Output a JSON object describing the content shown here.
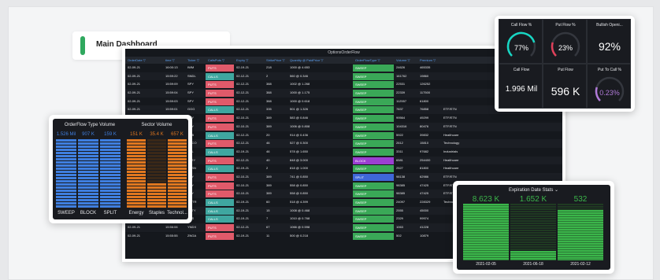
{
  "title": {
    "label": "Main Dashboard"
  },
  "table": {
    "title": "OptionsOrderFlow",
    "headers": [
      "OrderDate",
      "time",
      "Ticker",
      "CallsPuts",
      "Expiry",
      "StrikePrice",
      "Quantity @ PaidPrice",
      "OrderFlowType",
      "Volume",
      "Premium",
      ""
    ],
    "rows": [
      [
        "02-09-21",
        "16:00:13",
        "IWM",
        "PUTS",
        "02-19-21",
        "218",
        "1000 @ 4.653",
        "SWEEP",
        "24626",
        "465335",
        ""
      ],
      [
        "02-09-21",
        "15:59:22",
        "SNDL",
        "CALLS",
        "02-12-21",
        "2",
        "560 @ 0.346",
        "SWEEP",
        "161762",
        "19860",
        ""
      ],
      [
        "02-09-21",
        "15:59:09",
        "SPY",
        "PUTS",
        "02-12-21",
        "388",
        "1002 @ 1.268",
        "SWEEP",
        "22531",
        "126252",
        ""
      ],
      [
        "02-09-21",
        "15:59:04",
        "SPY",
        "PUTS",
        "02-12-21",
        "388",
        "1000 @ 1.175",
        "SWEEP",
        "22339",
        "117500",
        ""
      ],
      [
        "02-09-21",
        "15:59:03",
        "SPY",
        "PUTS",
        "02-12-21",
        "388",
        "1000 @ 0.618",
        "SWEEP",
        "112557",
        "61800",
        ""
      ],
      [
        "02-09-21",
        "15:59:01",
        "GGG",
        "CALLS",
        "02-12-21",
        "335",
        "501 @ 1.326",
        "SWEEP",
        "7837",
        "76858",
        "ETF/ETN"
      ],
      [
        "02-09-21",
        "15:58:57",
        "SPY",
        "PUTS",
        "02-10-21",
        "389",
        "583 @ 0.846",
        "SWEEP",
        "99564",
        "49299",
        "ETF/ETN"
      ],
      [
        "02-09-21",
        "15:58:55",
        "SPY",
        "PUTS",
        "02-10-21",
        "389",
        "1006 @ 0.808",
        "SWEEP",
        "104316",
        "80476",
        "ETF/ETN"
      ],
      [
        "02-09-21",
        "15:58:52",
        "ACB",
        "CALLS",
        "02-12-21",
        "20",
        "914 @ 0.436",
        "SWEEP",
        "5922",
        "39832",
        "Healthcare"
      ],
      [
        "02-09-21",
        "15:58:50",
        "CSCO",
        "PUTS",
        "02-12-21",
        "46",
        "527 @ 0.300",
        "SWEEP",
        "2612",
        "15810",
        "Technology"
      ],
      [
        "02-09-21",
        "15:58:47",
        "DAL",
        "CALLS",
        "02-19-21",
        "46",
        "578 @ 1.650",
        "SWEEP",
        "3311",
        "97682",
        "Industrials"
      ],
      [
        "02-09-21",
        "15:58:41",
        "TLRY",
        "PUTS",
        "02-12-21",
        "40",
        "848 @ 3.000",
        "BLOCK",
        "6581",
        "254400",
        "Healthcare"
      ],
      [
        "02-09-21",
        "15:58:38",
        "SESN",
        "CALLS",
        "02-19-21",
        "2",
        "818 @ 1.000",
        "SWEEP",
        "2527",
        "81800",
        "Healthcare"
      ],
      [
        "02-09-21",
        "15:58:36",
        "SPY",
        "PUTS",
        "02-10-21",
        "389",
        "741 @ 0.850",
        "SPLIT",
        "98138",
        "62986",
        "ETF/ETN"
      ],
      [
        "02-09-21",
        "15:58:33",
        "SPY",
        "PUTS",
        "02-10-21",
        "389",
        "558 @ 0.850",
        "SWEEP",
        "98385",
        "47425",
        "ETF/ETN"
      ],
      [
        "02-09-21",
        "15:58:31",
        "SPY",
        "PUTS",
        "02-10-21",
        "389",
        "558 @ 0.850",
        "SWEEP",
        "98385",
        "47425",
        "ETF/ETN"
      ],
      [
        "02-09-21",
        "15:58:29",
        "TWTR",
        "CALLS",
        "02-19-21",
        "60",
        "518 @ 4.399",
        "SWEEP",
        "24097",
        "228329",
        "Technology"
      ],
      [
        "02-09-21",
        "15:58:27",
        "SRTY",
        "CALLS",
        "02-19-21",
        "15",
        "1008 @ 0.468",
        "SWEEP",
        "2555",
        "45000",
        ""
      ],
      [
        "02-09-21",
        "15:56:26",
        "CVS",
        "CALLS",
        "02-19-21",
        "7",
        "1010 @ 0.768",
        "SWEEP",
        "2329",
        "99974",
        ""
      ],
      [
        "02-09-21",
        "15:56:06",
        "YNDX",
        "PUTS",
        "02-12-21",
        "67",
        "1066 @ 0.598",
        "SWEEP",
        "1063",
        "41228",
        ""
      ],
      [
        "02-09-21",
        "15:55:55",
        "ZNGA",
        "PUTS",
        "02-19-21",
        "11",
        "500 @ 0.218",
        "SWEEP",
        "502",
        "10879",
        ""
      ]
    ]
  },
  "orderflow_volume": {
    "title": "OrderFlow Type Volume",
    "values": [
      "1.526 Mil",
      "907 K",
      "159 K"
    ],
    "labels": [
      "SWEEP",
      "BLOCK",
      "SPLIT"
    ],
    "color": "#3f7fe0"
  },
  "sector_volume": {
    "title": "Sector Volume",
    "values": [
      "151 K",
      "35.4 K",
      "657 K"
    ],
    "labels": [
      "Energy",
      "Staples",
      "Technol..."
    ],
    "color": "#e0771f"
  },
  "metrics": [
    {
      "title": "Call Flow %",
      "value": "77%",
      "color": "#17d6c3",
      "fraction": 0.77
    },
    {
      "title": "Put Flow %",
      "value": "23%",
      "color": "#e0405a",
      "fraction": 0.23
    },
    {
      "title": "Bullish Openi...",
      "value": "92%"
    },
    {
      "title": "Call Flow",
      "value": "1.996 Mil"
    },
    {
      "title": "Put Flow",
      "value": "596 K"
    },
    {
      "title": "Put To Call %",
      "value": "0.23%",
      "color": "#b07ad8",
      "fraction": 0.23
    }
  ],
  "expiration": {
    "title": "Expiration Date Stats",
    "values": [
      "8.623 K",
      "1.652 K",
      "532"
    ],
    "labels": [
      "2021-02-05",
      "2021-06-18",
      "2021-02-12"
    ],
    "color": "#3bb54a"
  }
}
